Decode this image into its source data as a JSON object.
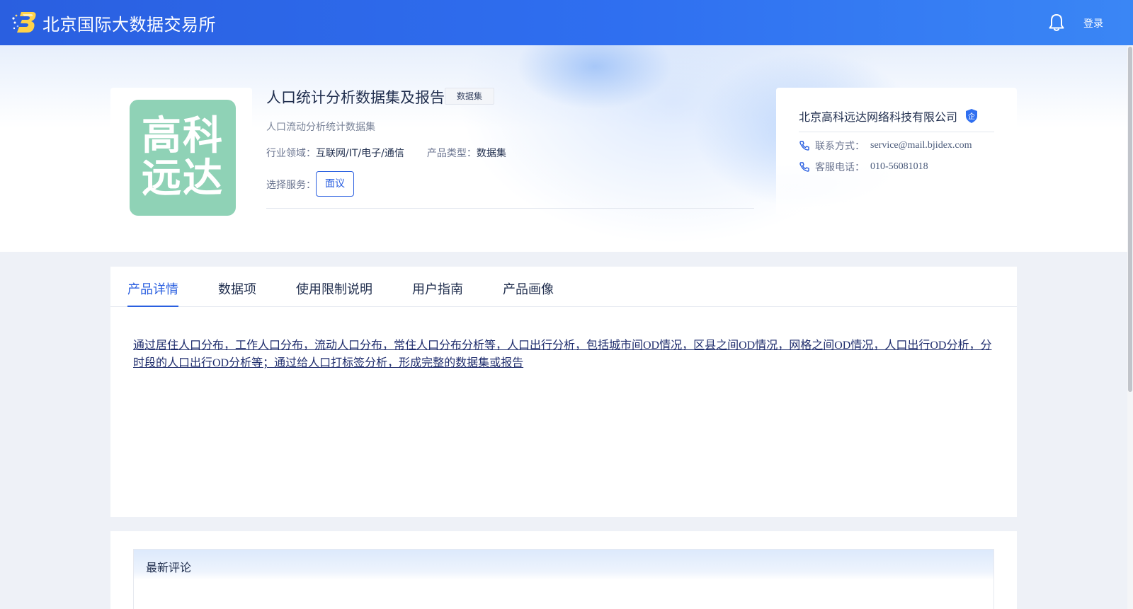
{
  "header": {
    "site_title": "北京国际大数据交易所",
    "login_label": "登录",
    "icons": [
      "logo-icon",
      "bell-icon"
    ]
  },
  "product": {
    "logo_lines": [
      "高科",
      "远达"
    ],
    "title": "人口统计分析数据集及报告",
    "tag": "数据集",
    "subtitle": "人口流动分析统计数据集",
    "industry_label": "行业领域：",
    "industry_value": "互联网/IT/电子/通信",
    "type_label": "产品类型：",
    "type_value": "数据集",
    "service_label": "选择服务：",
    "service_button": "面议"
  },
  "company": {
    "name": "北京高科远达网络科技有限公司",
    "badge": "企",
    "contact_label": "联系方式：",
    "contact_value": "service@mail.bjidex.com",
    "phone_label": "客服电话：",
    "phone_value": "010-56081018"
  },
  "tabs": [
    {
      "label": "产品详情",
      "active": true
    },
    {
      "label": "数据项",
      "active": false
    },
    {
      "label": "使用限制说明",
      "active": false
    },
    {
      "label": "用户指南",
      "active": false
    },
    {
      "label": "产品画像",
      "active": false
    }
  ],
  "description": "通过居住人口分布，工作人口分布，流动人口分布，常住人口分布分析等，人口出行分析，包括城市间OD情况，区县之间OD情况，网格之间OD情况，人口出行OD分析，分时段的人口出行OD分析等；通过给人口打标签分析，形成完整的数据集或报告",
  "comments": {
    "title": "最新评论"
  },
  "colors": {
    "brand": "#2a5fe0",
    "logo_bg": "#8fd2b6",
    "header_gradient_end": "#3a86f5"
  }
}
